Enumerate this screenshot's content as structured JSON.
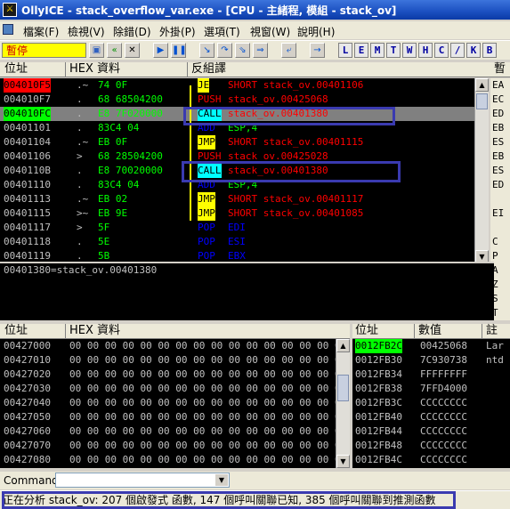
{
  "window": {
    "title": "OllyICE - stack_overflow_var.exe - [CPU - 主緒程, 模組 - stack_ov]",
    "app_icon": "debugger-icon"
  },
  "menu": [
    {
      "label": "檔案(F)"
    },
    {
      "label": "檢視(V)"
    },
    {
      "label": "除錯(D)"
    },
    {
      "label": "外掛(P)"
    },
    {
      "label": "選項(T)"
    },
    {
      "label": "視窗(W)"
    },
    {
      "label": "說明(H)"
    }
  ],
  "toolbar": {
    "state": "暫停",
    "buttons": [
      "open-icon",
      "restart-icon",
      "close-icon",
      "run-icon",
      "pause-icon",
      "step-into-icon",
      "step-over-icon",
      "trace-into-icon",
      "trace-over-icon",
      "execute-till-return-icon",
      "goto-icon"
    ],
    "letters": [
      "L",
      "E",
      "M",
      "T",
      "W",
      "H",
      "C",
      "/",
      "K",
      "B"
    ]
  },
  "disasm": {
    "headers": {
      "address": "位址",
      "hex": "HEX 資料",
      "disasm": "反組譯",
      "registers": "暫"
    },
    "rows": [
      {
        "addr": "004010F5",
        "mark": ".~",
        "hex": "74 0F",
        "instr": "JE",
        "args": "SHORT stack_ov.00401106"
      },
      {
        "addr": "004010F7",
        "mark": ".",
        "hex": "68 68504200",
        "instr": "PUSH",
        "args": "stack_ov.00425068"
      },
      {
        "addr": "004010FC",
        "mark": ".",
        "hex": "E8 7F020000",
        "instr": "CALL",
        "args": "stack_ov.00401380"
      },
      {
        "addr": "00401101",
        "mark": ".",
        "hex": "83C4 04",
        "instr": "ADD",
        "args": "ESP,4"
      },
      {
        "addr": "00401104",
        "mark": ".~",
        "hex": "EB 0F",
        "instr": "JMP",
        "args": "SHORT stack_ov.00401115"
      },
      {
        "addr": "00401106",
        "mark": ">",
        "hex": "68 28504200",
        "instr": "PUSH",
        "args": "stack_ov.00425028"
      },
      {
        "addr": "0040110B",
        "mark": ".",
        "hex": "E8 70020000",
        "instr": "CALL",
        "args": "stack_ov.00401380"
      },
      {
        "addr": "00401110",
        "mark": ".",
        "hex": "83C4 04",
        "instr": "ADD",
        "args": "ESP,4"
      },
      {
        "addr": "00401113",
        "mark": ".~",
        "hex": "EB 02",
        "instr": "JMP",
        "args": "SHORT stack_ov.00401117"
      },
      {
        "addr": "00401115",
        "mark": ">~",
        "hex": "EB 9E",
        "instr": "JMP",
        "args": "SHORT stack_ov.00401085"
      },
      {
        "addr": "00401117",
        "mark": ">",
        "hex": "5F",
        "instr": "POP",
        "args": "EDI"
      },
      {
        "addr": "00401118",
        "mark": ".",
        "hex": "5E",
        "instr": "POP",
        "args": "ESI"
      },
      {
        "addr": "00401119",
        "mark": ".",
        "hex": "5B",
        "instr": "POP",
        "args": "EBX"
      }
    ],
    "registers": [
      "EA",
      "EC",
      "ED",
      "EB",
      "ES",
      "EB",
      "ES",
      "ED",
      "",
      "EI",
      "",
      "C",
      "P",
      "A",
      "Z",
      "S",
      "T",
      "D"
    ]
  },
  "info": {
    "line": "00401380=stack_ov.00401380"
  },
  "dump": {
    "headers": {
      "address": "位址",
      "hex": "HEX 資料"
    },
    "rows": [
      {
        "addr": "00427000",
        "hex": "00 00 00 00 00 00 00 00 00 00 00 00 00 00 00 0"
      },
      {
        "addr": "00427010",
        "hex": "00 00 00 00 00 00 00 00 00 00 00 00 00 00 00 0"
      },
      {
        "addr": "00427020",
        "hex": "00 00 00 00 00 00 00 00 00 00 00 00 00 00 00 0"
      },
      {
        "addr": "00427030",
        "hex": "00 00 00 00 00 00 00 00 00 00 00 00 00 00 00 0"
      },
      {
        "addr": "00427040",
        "hex": "00 00 00 00 00 00 00 00 00 00 00 00 00 00 00 0"
      },
      {
        "addr": "00427050",
        "hex": "00 00 00 00 00 00 00 00 00 00 00 00 00 00 00 0"
      },
      {
        "addr": "00427060",
        "hex": "00 00 00 00 00 00 00 00 00 00 00 00 00 00 00 0"
      },
      {
        "addr": "00427070",
        "hex": "00 00 00 00 00 00 00 00 00 00 00 00 00 00 00 0"
      },
      {
        "addr": "00427080",
        "hex": "00 00 00 00 00 00 00 00 00 00 00 00 00 00 00 0"
      }
    ]
  },
  "stack": {
    "headers": {
      "address": "位址",
      "value": "數值",
      "comment": "註"
    },
    "rows": [
      {
        "addr": "0012FB2C",
        "value": "00425068",
        "comment": "Lar"
      },
      {
        "addr": "0012FB30",
        "value": "7C930738",
        "comment": "ntd"
      },
      {
        "addr": "0012FB34",
        "value": "FFFFFFFF",
        "comment": ""
      },
      {
        "addr": "0012FB38",
        "value": "7FFD4000",
        "comment": ""
      },
      {
        "addr": "0012FB3C",
        "value": "CCCCCCCC",
        "comment": ""
      },
      {
        "addr": "0012FB40",
        "value": "CCCCCCCC",
        "comment": ""
      },
      {
        "addr": "0012FB44",
        "value": "CCCCCCCC",
        "comment": ""
      },
      {
        "addr": "0012FB48",
        "value": "CCCCCCCC",
        "comment": ""
      },
      {
        "addr": "0012FB4C",
        "value": "CCCCCCCC",
        "comment": ""
      }
    ]
  },
  "command": {
    "label": "Command",
    "value": ""
  },
  "status": {
    "text": "正在分析 stack_ov: 207 個啟發式 函數, 147 個呼叫關聯已知, 385 個呼叫關聯到推測函數"
  },
  "colors": {
    "addr_selected_bg": "#ff0000",
    "addr_current_bg": "#00ff00",
    "addr_text": "#c0c0c0",
    "hex_text": "#00ff00",
    "jump_bg": "#ffff00",
    "jump_text": "#ff0000",
    "call_bg": "#00ffff",
    "call_text": "#ff0000",
    "push_text": "#ff0000",
    "default_text": "#c0c0c0",
    "highlight_row": "#808080"
  }
}
